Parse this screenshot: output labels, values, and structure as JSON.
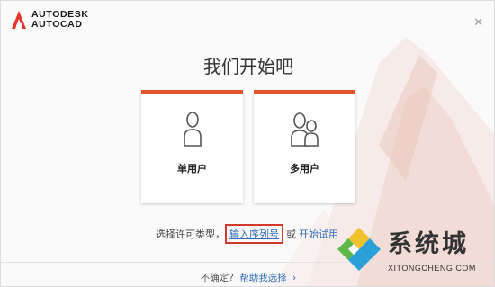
{
  "logo": {
    "line1": "AUTODESK",
    "line2": "AUTOCAD",
    "icon": "autocad-a-logo",
    "brand_color": "#e0352b"
  },
  "close_icon": "close-icon",
  "title": "我们开始吧",
  "cards": [
    {
      "label": "单用户",
      "icon": "single-user-icon"
    },
    {
      "label": "多用户",
      "icon": "multi-user-icon"
    }
  ],
  "license": {
    "prompt": "选择许可类型，",
    "serial_link": "输入序列号",
    "or": "或",
    "trial_link": "开始试用"
  },
  "footer": {
    "question": "不确定?",
    "help_link": "帮助我选择",
    "chevron_icon": "chevron-right-icon"
  },
  "watermark": {
    "text": "系统城",
    "url": "XITONGCHENG.COM"
  },
  "colors": {
    "accent": "#e2542a",
    "link": "#2f6bb8",
    "highlight_box": "#d33a2c"
  }
}
